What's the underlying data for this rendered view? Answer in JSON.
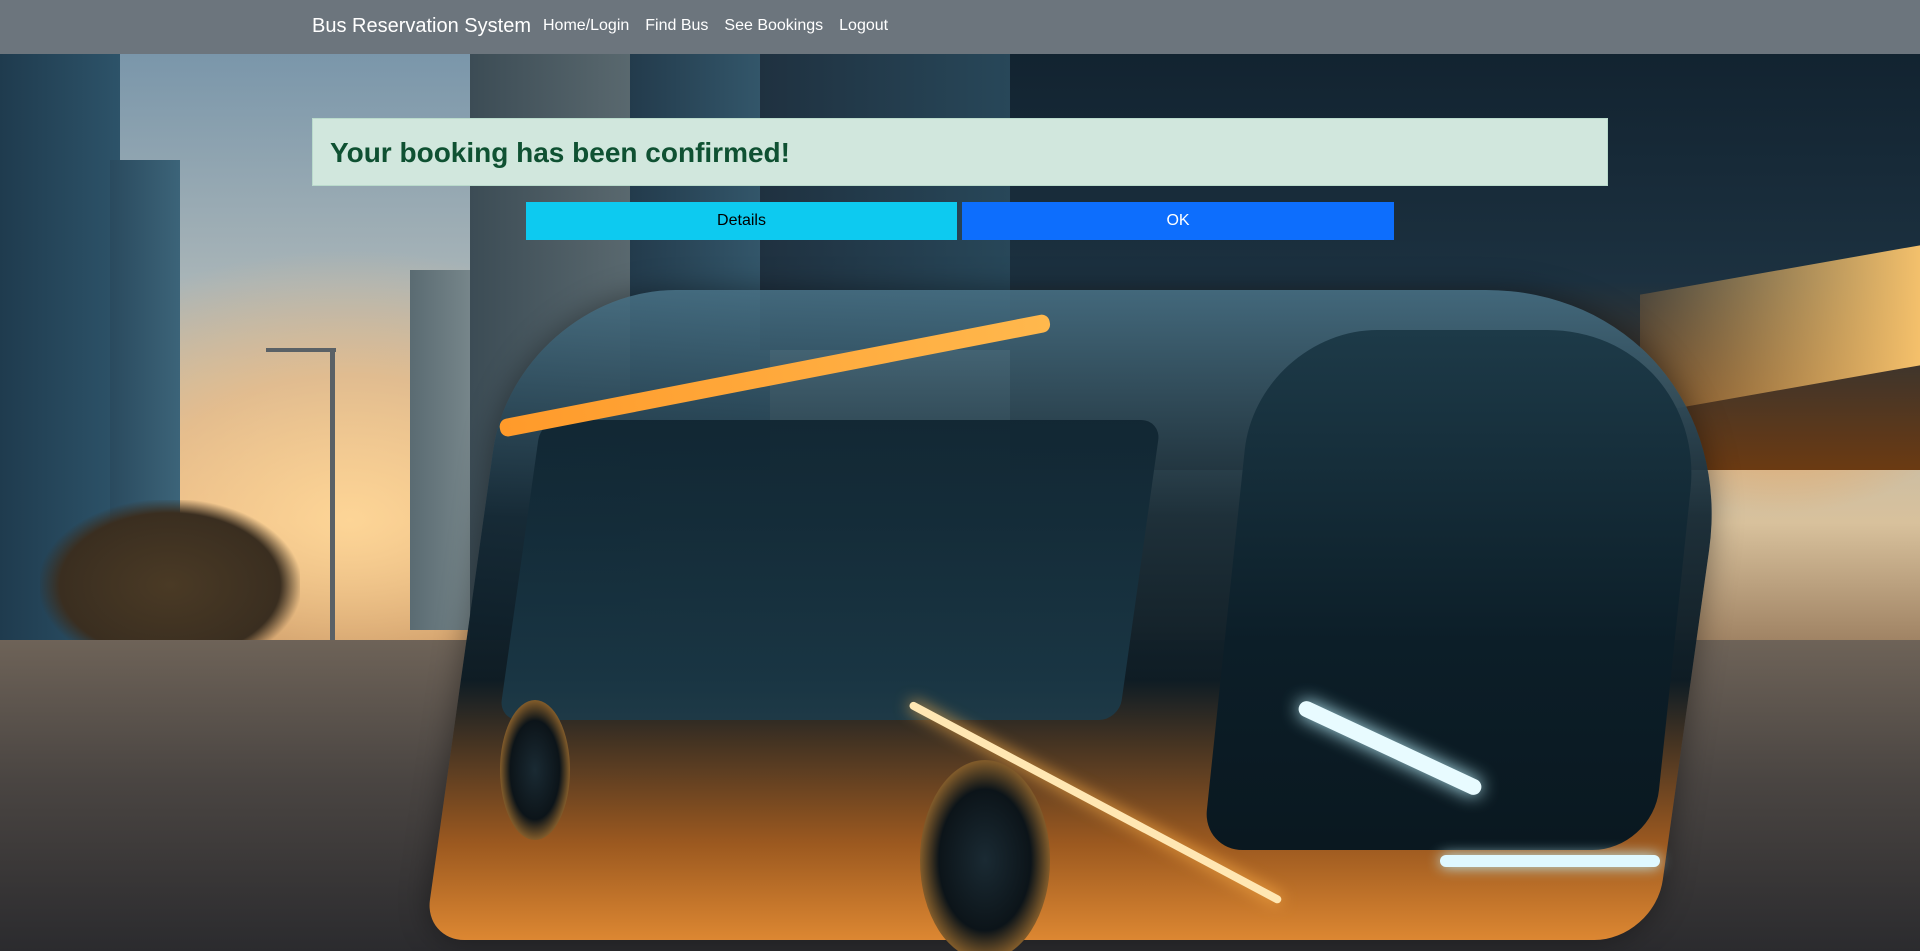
{
  "navbar": {
    "brand": "Bus Reservation System",
    "links": [
      {
        "label": "Home/Login"
      },
      {
        "label": "Find Bus"
      },
      {
        "label": "See Bookings"
      },
      {
        "label": "Logout"
      }
    ],
    "bg_color": "#6c757d"
  },
  "alert": {
    "message": "Your booking has been confirmed!",
    "bg_color": "#d1e7dd",
    "text_color": "#0f5132"
  },
  "actions": {
    "details_label": "Details",
    "ok_label": "OK",
    "details_color": "#0dcaf0",
    "ok_color": "#0d6efd"
  },
  "background": {
    "icon": "futuristic-bus-city-background-image"
  }
}
